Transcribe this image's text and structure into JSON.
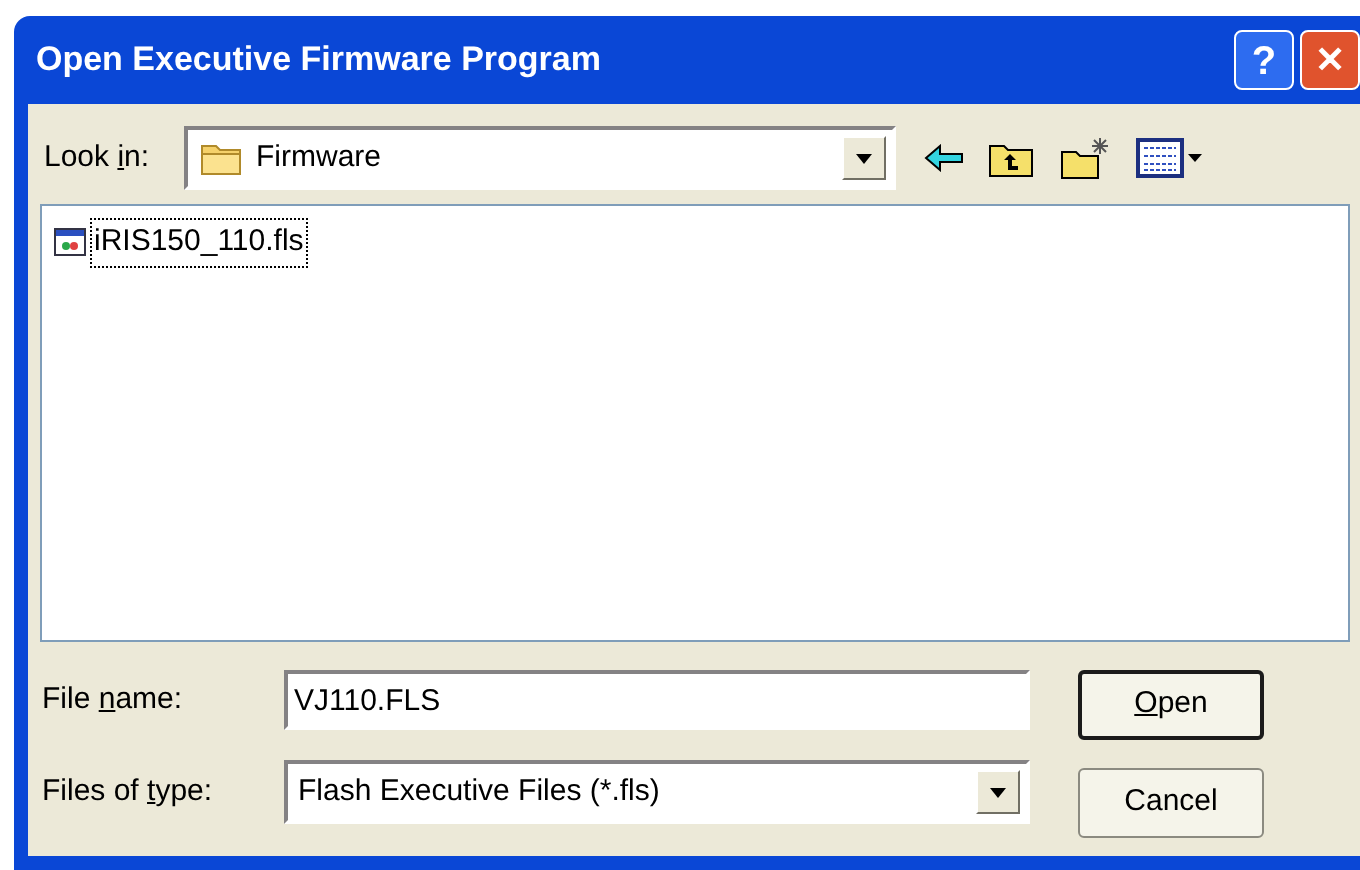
{
  "window": {
    "title": "Open Executive Firmware Program",
    "help_button": "?",
    "close_button": "✕"
  },
  "look_in": {
    "label": {
      "before": "Look ",
      "key": "i",
      "after": "n:"
    },
    "value": "Firmware"
  },
  "files": [
    {
      "name": "iRIS150_110.fls",
      "focused": true
    }
  ],
  "file_name": {
    "label": {
      "before": "File ",
      "key": "n",
      "after": "ame:"
    },
    "value": "VJ110.FLS"
  },
  "file_type": {
    "label": {
      "before": "Files of ",
      "key": "t",
      "after": "ype:"
    },
    "value": "Flash Executive Files (*.fls)"
  },
  "buttons": [
    {
      "label": {
        "key": "O",
        "after": "pen"
      },
      "default": true
    },
    {
      "label": {
        "before": "Cancel"
      },
      "default": false
    }
  ]
}
